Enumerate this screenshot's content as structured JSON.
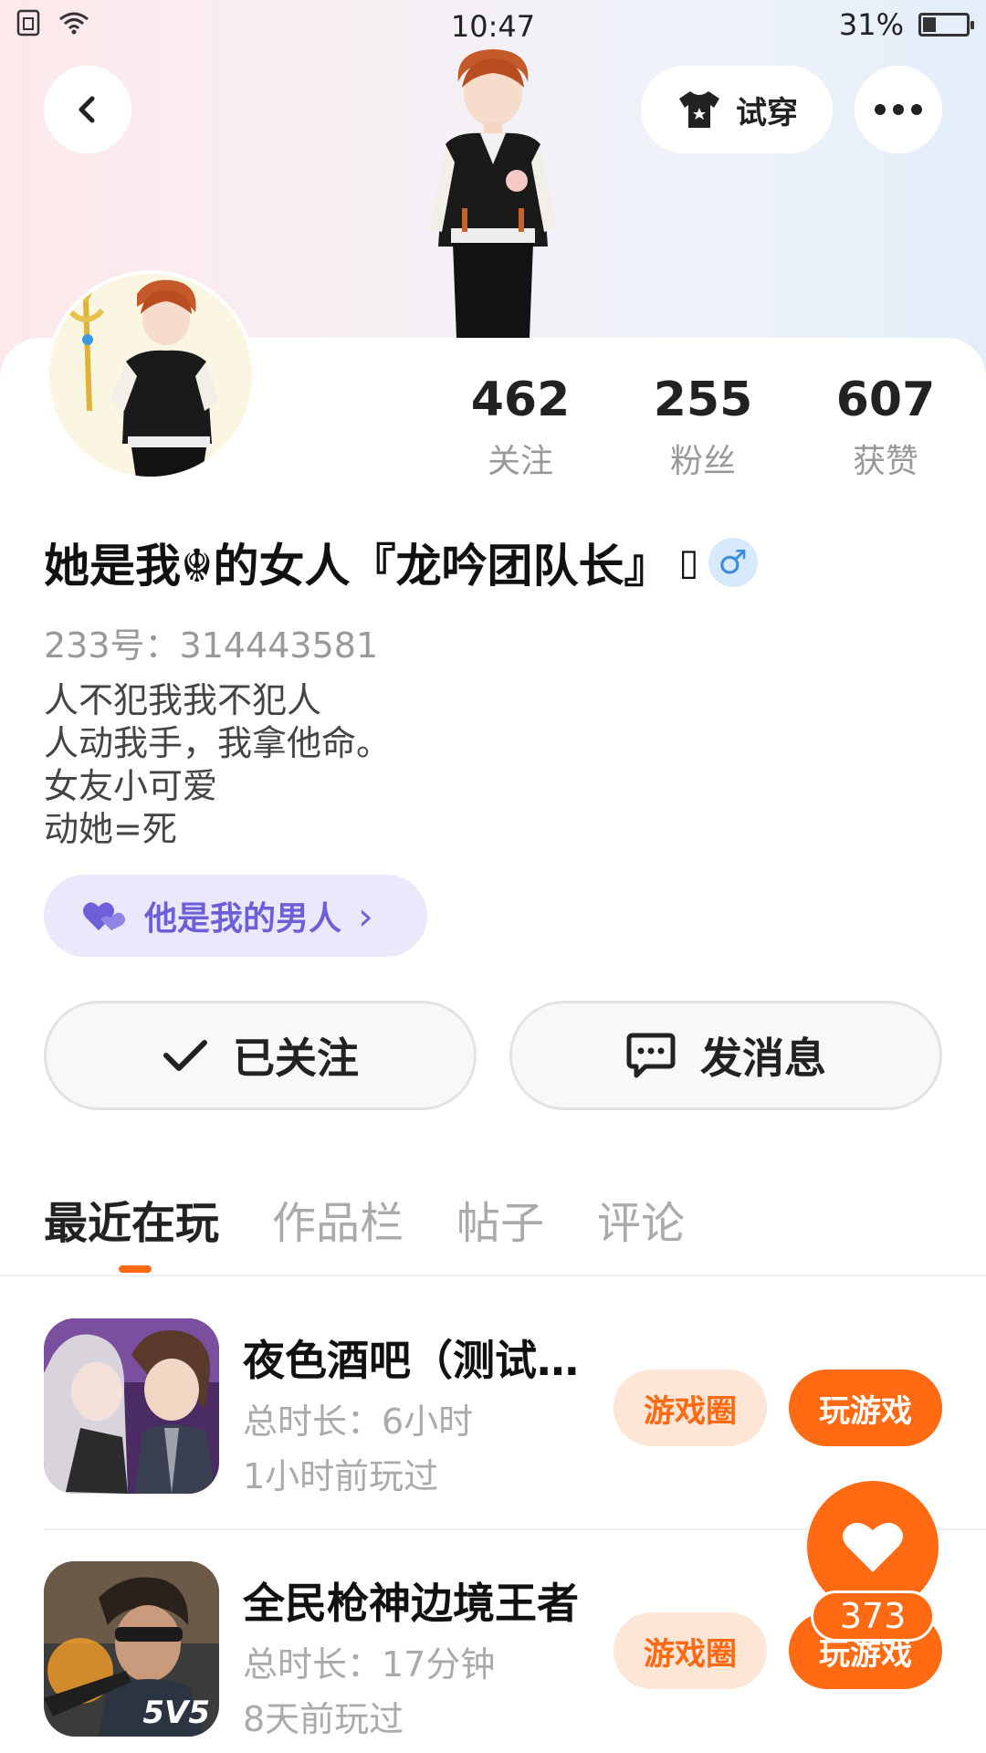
{
  "status_bar": {
    "time": "10:47",
    "battery_text": "31%",
    "battery_level": 0.31
  },
  "header": {
    "try_on_label": "试穿",
    "back_icon": "chevron-left-icon",
    "more_icon": "more-dots-icon",
    "try_on_icon": "shirt-icon"
  },
  "profile": {
    "stats": [
      {
        "value": "462",
        "label": "关注"
      },
      {
        "value": "255",
        "label": "粉丝"
      },
      {
        "value": "607",
        "label": "获赞"
      }
    ],
    "nickname": "她是我☬的女人『龙吟团队长』",
    "nickname_suffix": "▯",
    "gender_symbol": "♂",
    "uid": "233号：314443581",
    "bio_lines": [
      "人不犯我我不犯人",
      "人动我手，我拿他命。",
      "女友小可爱",
      "动她=死"
    ]
  },
  "relation": {
    "label": "他是我的男人",
    "chevron": "›"
  },
  "actions": {
    "follow_label": "已关注",
    "message_label": "发消息"
  },
  "tabs": [
    {
      "label": "最近在玩",
      "active": true
    },
    {
      "label": "作品栏",
      "active": false
    },
    {
      "label": "帖子",
      "active": false
    },
    {
      "label": "评论",
      "active": false
    }
  ],
  "games": [
    {
      "title": "夜色酒吧（测试服）",
      "total_time": "总时长：6小时",
      "last_played": "1小时前玩过",
      "circle_label": "游戏圈",
      "play_label": "玩游戏"
    },
    {
      "title": "全民枪神边境王者",
      "total_time": "总时长：17分钟",
      "last_played": "8天前玩过",
      "circle_label": "游戏圈",
      "play_label": "玩游戏",
      "icon_text": "5V5"
    }
  ],
  "like_fab": {
    "count": "373"
  },
  "colors": {
    "accent": "#ff6a13",
    "relation": "#6d5fd8",
    "gender": "#3b8de0"
  }
}
